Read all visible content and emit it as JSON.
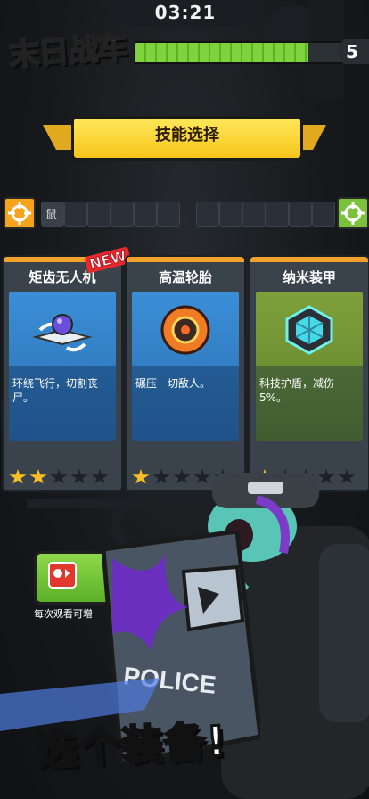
{
  "hud": {
    "timer": "03:21",
    "game_title": "末日战车",
    "level": "5",
    "level_progress": 0.82
  },
  "skill_select": {
    "title": "技能选择",
    "slots_filled": 1,
    "slot_icon_label": "鼠"
  },
  "cards": [
    {
      "name": "矩齿无人机",
      "description": "环绕飞行，切割丧尸。",
      "is_new": true,
      "new_label": "NEW",
      "stars_total": 5,
      "stars_on": 2,
      "art_color": "blue",
      "icon": "drone-blade-icon"
    },
    {
      "name": "高温轮胎",
      "description": "碾压一切敌人。",
      "is_new": false,
      "stars_total": 5,
      "stars_on": 1,
      "art_color": "blue",
      "icon": "fire-tire-icon"
    },
    {
      "name": "纳米装甲",
      "description": "科技护盾，减伤5%。",
      "is_new": false,
      "stars_total": 5,
      "stars_on": 1,
      "art_color": "green",
      "icon": "nano-armor-icon"
    }
  ],
  "ad": {
    "caption": "每次观看可增"
  },
  "promo": {
    "slogan": "选个装备!",
    "shield_text": "POLICE"
  },
  "colors": {
    "accent_yellow": "#f6c51a",
    "progress_green": "#7ed23b",
    "card_orange": "#f2a12a",
    "star_gold": "#f6c026",
    "new_red": "#e52a2f"
  }
}
